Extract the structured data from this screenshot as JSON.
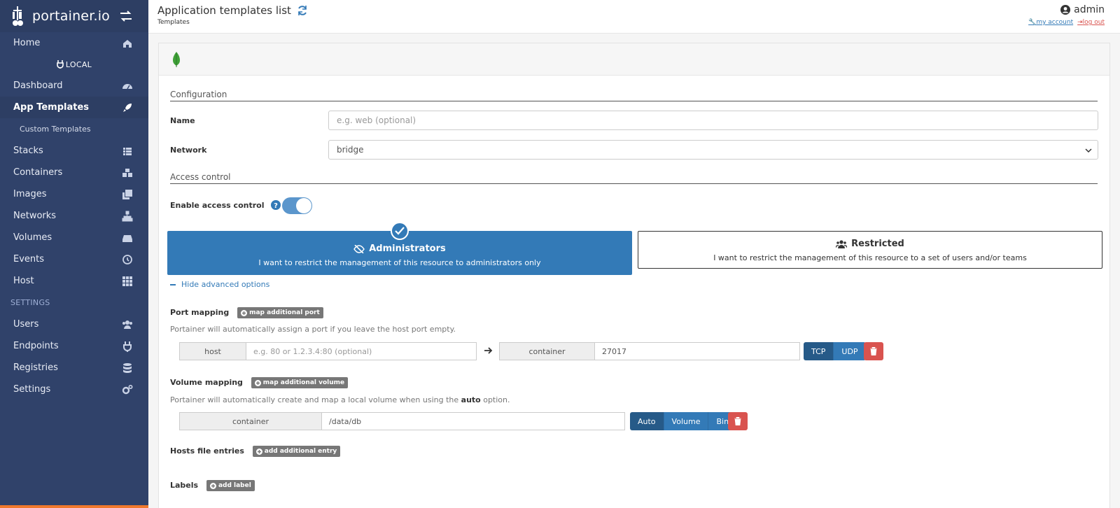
{
  "app": {
    "logo_text": "portainer.io"
  },
  "sidebar": {
    "items": [
      {
        "label": "Home",
        "icon": "home-icon"
      },
      {
        "label": "Dashboard",
        "icon": "tachometer-icon"
      },
      {
        "label": "App Templates",
        "icon": "rocket-icon"
      },
      {
        "label": "Custom Templates"
      },
      {
        "label": "Stacks",
        "icon": "list-icon"
      },
      {
        "label": "Containers",
        "icon": "cubes-icon"
      },
      {
        "label": "Images",
        "icon": "clone-icon"
      },
      {
        "label": "Networks",
        "icon": "sitemap-icon"
      },
      {
        "label": "Volumes",
        "icon": "hdd-icon"
      },
      {
        "label": "Events",
        "icon": "history-icon"
      },
      {
        "label": "Host",
        "icon": "th-icon"
      }
    ],
    "endpoint_label": "LOCAL",
    "settings_title": "SETTINGS",
    "settings_items": [
      {
        "label": "Users",
        "icon": "users-icon"
      },
      {
        "label": "Endpoints",
        "icon": "plug-icon"
      },
      {
        "label": "Registries",
        "icon": "database-icon"
      },
      {
        "label": "Settings",
        "icon": "cogs-icon"
      }
    ]
  },
  "header": {
    "title": "Application templates list",
    "breadcrumb": "Templates",
    "user": "admin",
    "my_account": "my account",
    "log_out": "log out"
  },
  "form": {
    "configuration_legend": "Configuration",
    "name_label": "Name",
    "name_placeholder": "e.g. web (optional)",
    "network_label": "Network",
    "network_value": "bridge",
    "access_control_legend": "Access control",
    "enable_access_control_label": "Enable access control",
    "enable_access_control": true,
    "administrators_title": "Administrators",
    "administrators_desc": "I want to restrict the management of this resource to administrators only",
    "restricted_title": "Restricted",
    "restricted_desc": "I want to restrict the management of this resource to a set of users and/or teams",
    "hide_advanced": "Hide advanced options",
    "port_mapping_label": "Port mapping",
    "map_port_button": "map additional port",
    "port_help": "Portainer will automatically assign a port if you leave the host port empty.",
    "host_addon": "host",
    "host_placeholder": "e.g. 80 or 1.2.3.4:80 (optional)",
    "container_addon": "container",
    "container_port": "27017",
    "protocols": [
      "TCP",
      "UDP"
    ],
    "volume_mapping_label": "Volume mapping",
    "map_volume_button": "map additional volume",
    "volume_help_prefix": "Portainer will automatically create and map a local volume when using the ",
    "volume_help_bold": "auto",
    "volume_help_suffix": " option.",
    "volume_container_addon": "container",
    "volume_path": "/data/db",
    "volume_types": [
      "Auto",
      "Volume",
      "Bind"
    ],
    "hosts_label": "Hosts file entries",
    "add_entry_button": "add additional entry",
    "labels_label": "Labels",
    "add_label_button": "add label"
  },
  "colors": {
    "sidebar": "#30426a",
    "primary": "#337ab7",
    "danger": "#d9534f",
    "accent": "#f0782d"
  }
}
